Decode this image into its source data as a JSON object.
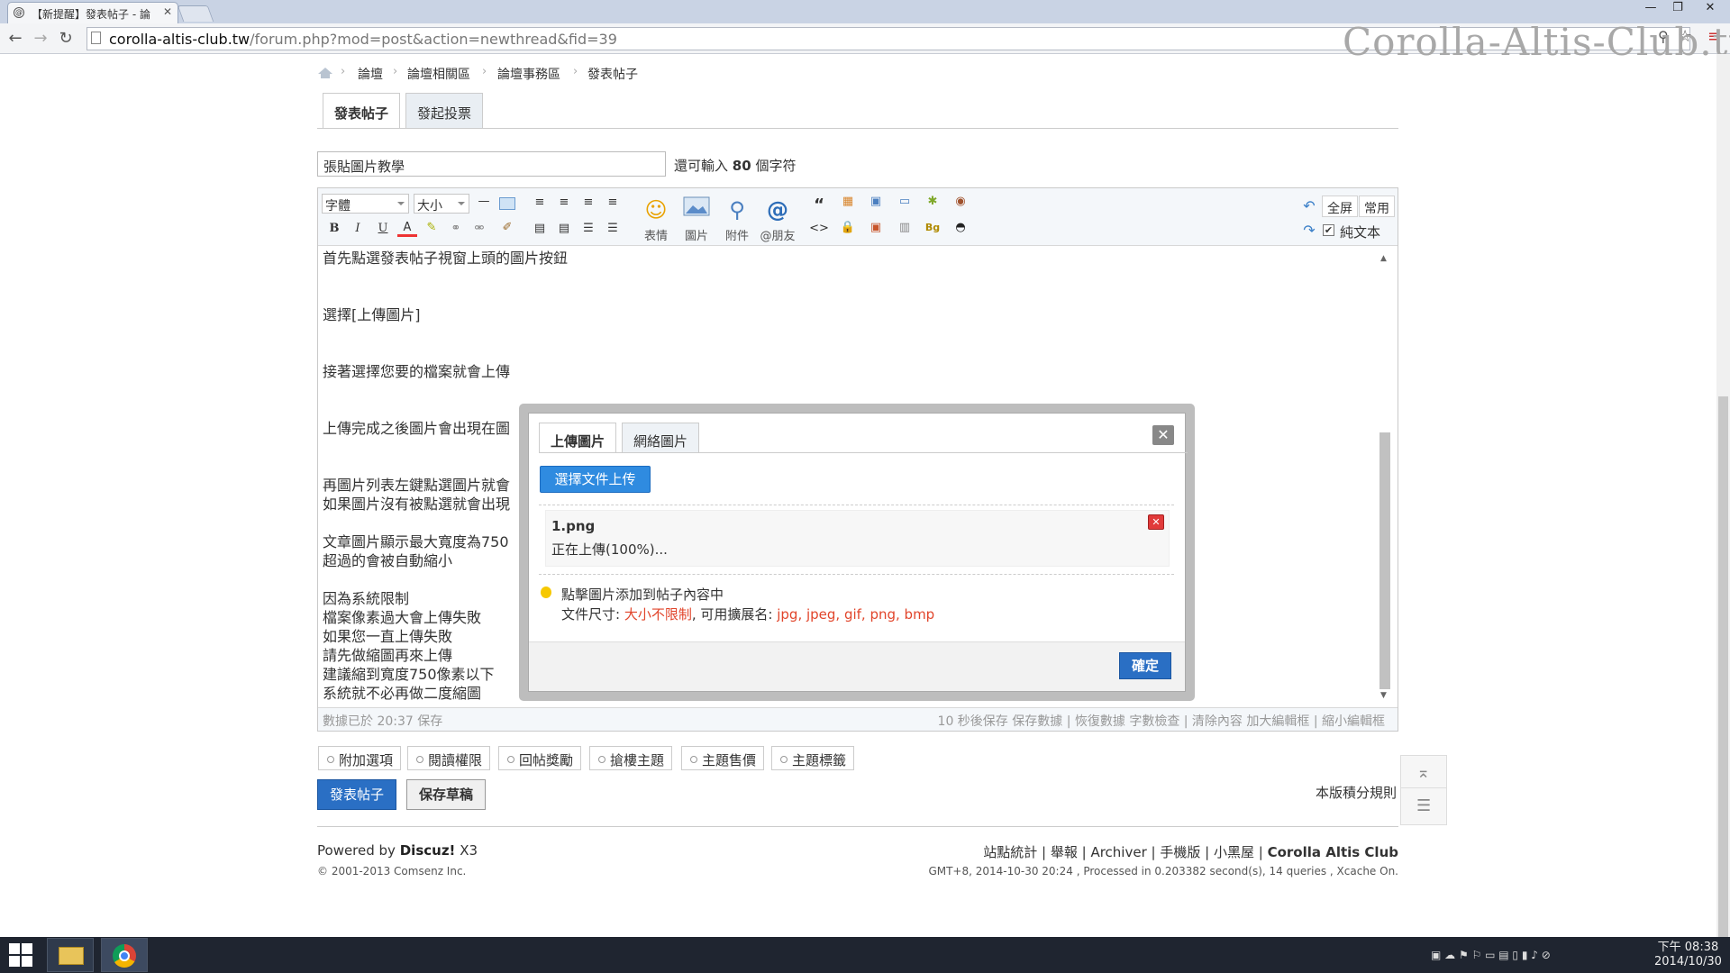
{
  "browser": {
    "tab_title": "【新提醒】發表帖子 - 論",
    "url_domain": "corolla-altis-club.tw",
    "url_path": "/forum.php?mod=post&action=newthread&fid=39",
    "watermark": "Corolla-Altis-Club.tw"
  },
  "breadcrumb": [
    "論壇",
    "論壇相關區",
    "論壇事務區",
    "發表帖子"
  ],
  "post_tabs": [
    "發表帖子",
    "發起投票"
  ],
  "subject": {
    "value": "張貼圖片教學",
    "hint_prefix": "還可輸入",
    "hint_count": "80",
    "hint_suffix": "個字符"
  },
  "toolbar": {
    "font_select": "字體",
    "size_select": "大小",
    "bold": "B",
    "italic": "I",
    "underline": "U",
    "color": "A",
    "emoticon_label": "表情",
    "image_label": "圖片",
    "attach_label": "附件",
    "at_label": "@朋友",
    "quote": "“",
    "code": "<>",
    "fullscreen": "全屏",
    "common": "常用",
    "plaintext": "純文本"
  },
  "content_lines": [
    "首先點選發表帖子視窗上頭的圖片按鈕",
    "",
    "",
    "選擇[上傳圖片]",
    "",
    "",
    "接著選擇您要的檔案就會上傳",
    "",
    "",
    "上傳完成之後圖片會出現在圖",
    "",
    "",
    "再圖片列表左鍵點選圖片就會",
    "如果圖片沒有被點選就會出現",
    "",
    "文章圖片顯示最大寬度為750",
    "超過的會被自動縮小",
    "",
    "因為系統限制",
    "檔案像素過大會上傳失敗",
    "如果您一直上傳失敗",
    "請先做縮圖再來上傳",
    "建議縮到寬度750像素以下",
    "系統就不必再做二度縮圖"
  ],
  "editor_status": {
    "left": "數據已於 20:37 保存",
    "right": "10 秒後保存 保存數據 | 恢復數據    字數檢查 | 清除內容    加大編輯框 | 縮小編輯框"
  },
  "options": [
    "附加選項",
    "閱讀權限",
    "回帖獎勵",
    "搶樓主題",
    "主題售價",
    "主題標籤"
  ],
  "actions": {
    "submit": "發表帖子",
    "draft": "保存草稿",
    "rules": "本版積分規則"
  },
  "footer": {
    "powered_prefix": "Powered by",
    "powered_brand": "Discuz!",
    "powered_ver": "X3",
    "copyright": "© 2001-2013 Comsenz Inc.",
    "links": [
      "站點統計",
      "舉報",
      "Archiver",
      "手機版",
      "小黑屋",
      "Corolla Altis Club"
    ],
    "info": "GMT+8, 2014-10-30 20:24 , Processed in 0.203382 second(s), 14 queries , Xcache On."
  },
  "dialog": {
    "tabs": [
      "上傳圖片",
      "網絡圖片"
    ],
    "upload_button": "選擇文件上传",
    "file_name": "1.png",
    "file_progress": "正在上傳(100%)...",
    "progress_value": 100,
    "tip": "點擊圖片添加到帖子內容中",
    "size_prefix": "文件尺寸:",
    "size_value": "大小不限制",
    "ext_prefix": ", 可用擴展名:",
    "ext_value": "jpg, jpeg, gif, png, bmp",
    "ok": "確定"
  },
  "taskbar": {
    "time": "下午 08:38",
    "date": "2014/10/30"
  },
  "colors": {
    "primary_button": "#2a6fc4",
    "dialog_upload_button": "#2f8be0",
    "warning_red": "#e1452b"
  }
}
